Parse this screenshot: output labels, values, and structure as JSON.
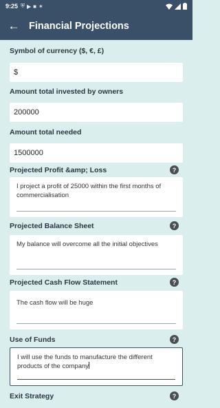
{
  "status_bar": {
    "time": "9:25",
    "icons": [
      "shield-icon",
      "play-circle-icon",
      "sim-icon",
      "compass-icon"
    ],
    "right_icons": [
      "wifi-icon",
      "signal-icon",
      "battery-icon"
    ]
  },
  "app_bar": {
    "title": "Financial Projections",
    "back_icon": "arrow-left-icon"
  },
  "fields": {
    "currency": {
      "label": "Symbol of currency ($, €, £)",
      "value": "$"
    },
    "invested": {
      "label": "Amount total invested by owners",
      "value": "200000"
    },
    "needed": {
      "label": "Amount total needed",
      "value": "1500000"
    },
    "profit_loss": {
      "label": "Projected Profit &amp; Loss",
      "value": "I project a profit of 25000 within the first months of commercialisation"
    },
    "balance_sheet": {
      "label": "Projected Balance Sheet",
      "value": "My balance will overcome all the initial objectives"
    },
    "cash_flow": {
      "label": "Projected Cash Flow Statement",
      "value": "The cash flow will be huge"
    },
    "use_of_funds": {
      "label": "Use of Funds",
      "value": "I will use the funds to manufacture the different products of the company"
    },
    "exit_strategy": {
      "label": "Exit Strategy"
    }
  },
  "help_label": "?",
  "colors": {
    "app_bar": "#3a5068",
    "background": "#daeeee",
    "help_badge": "#4a4f55"
  }
}
